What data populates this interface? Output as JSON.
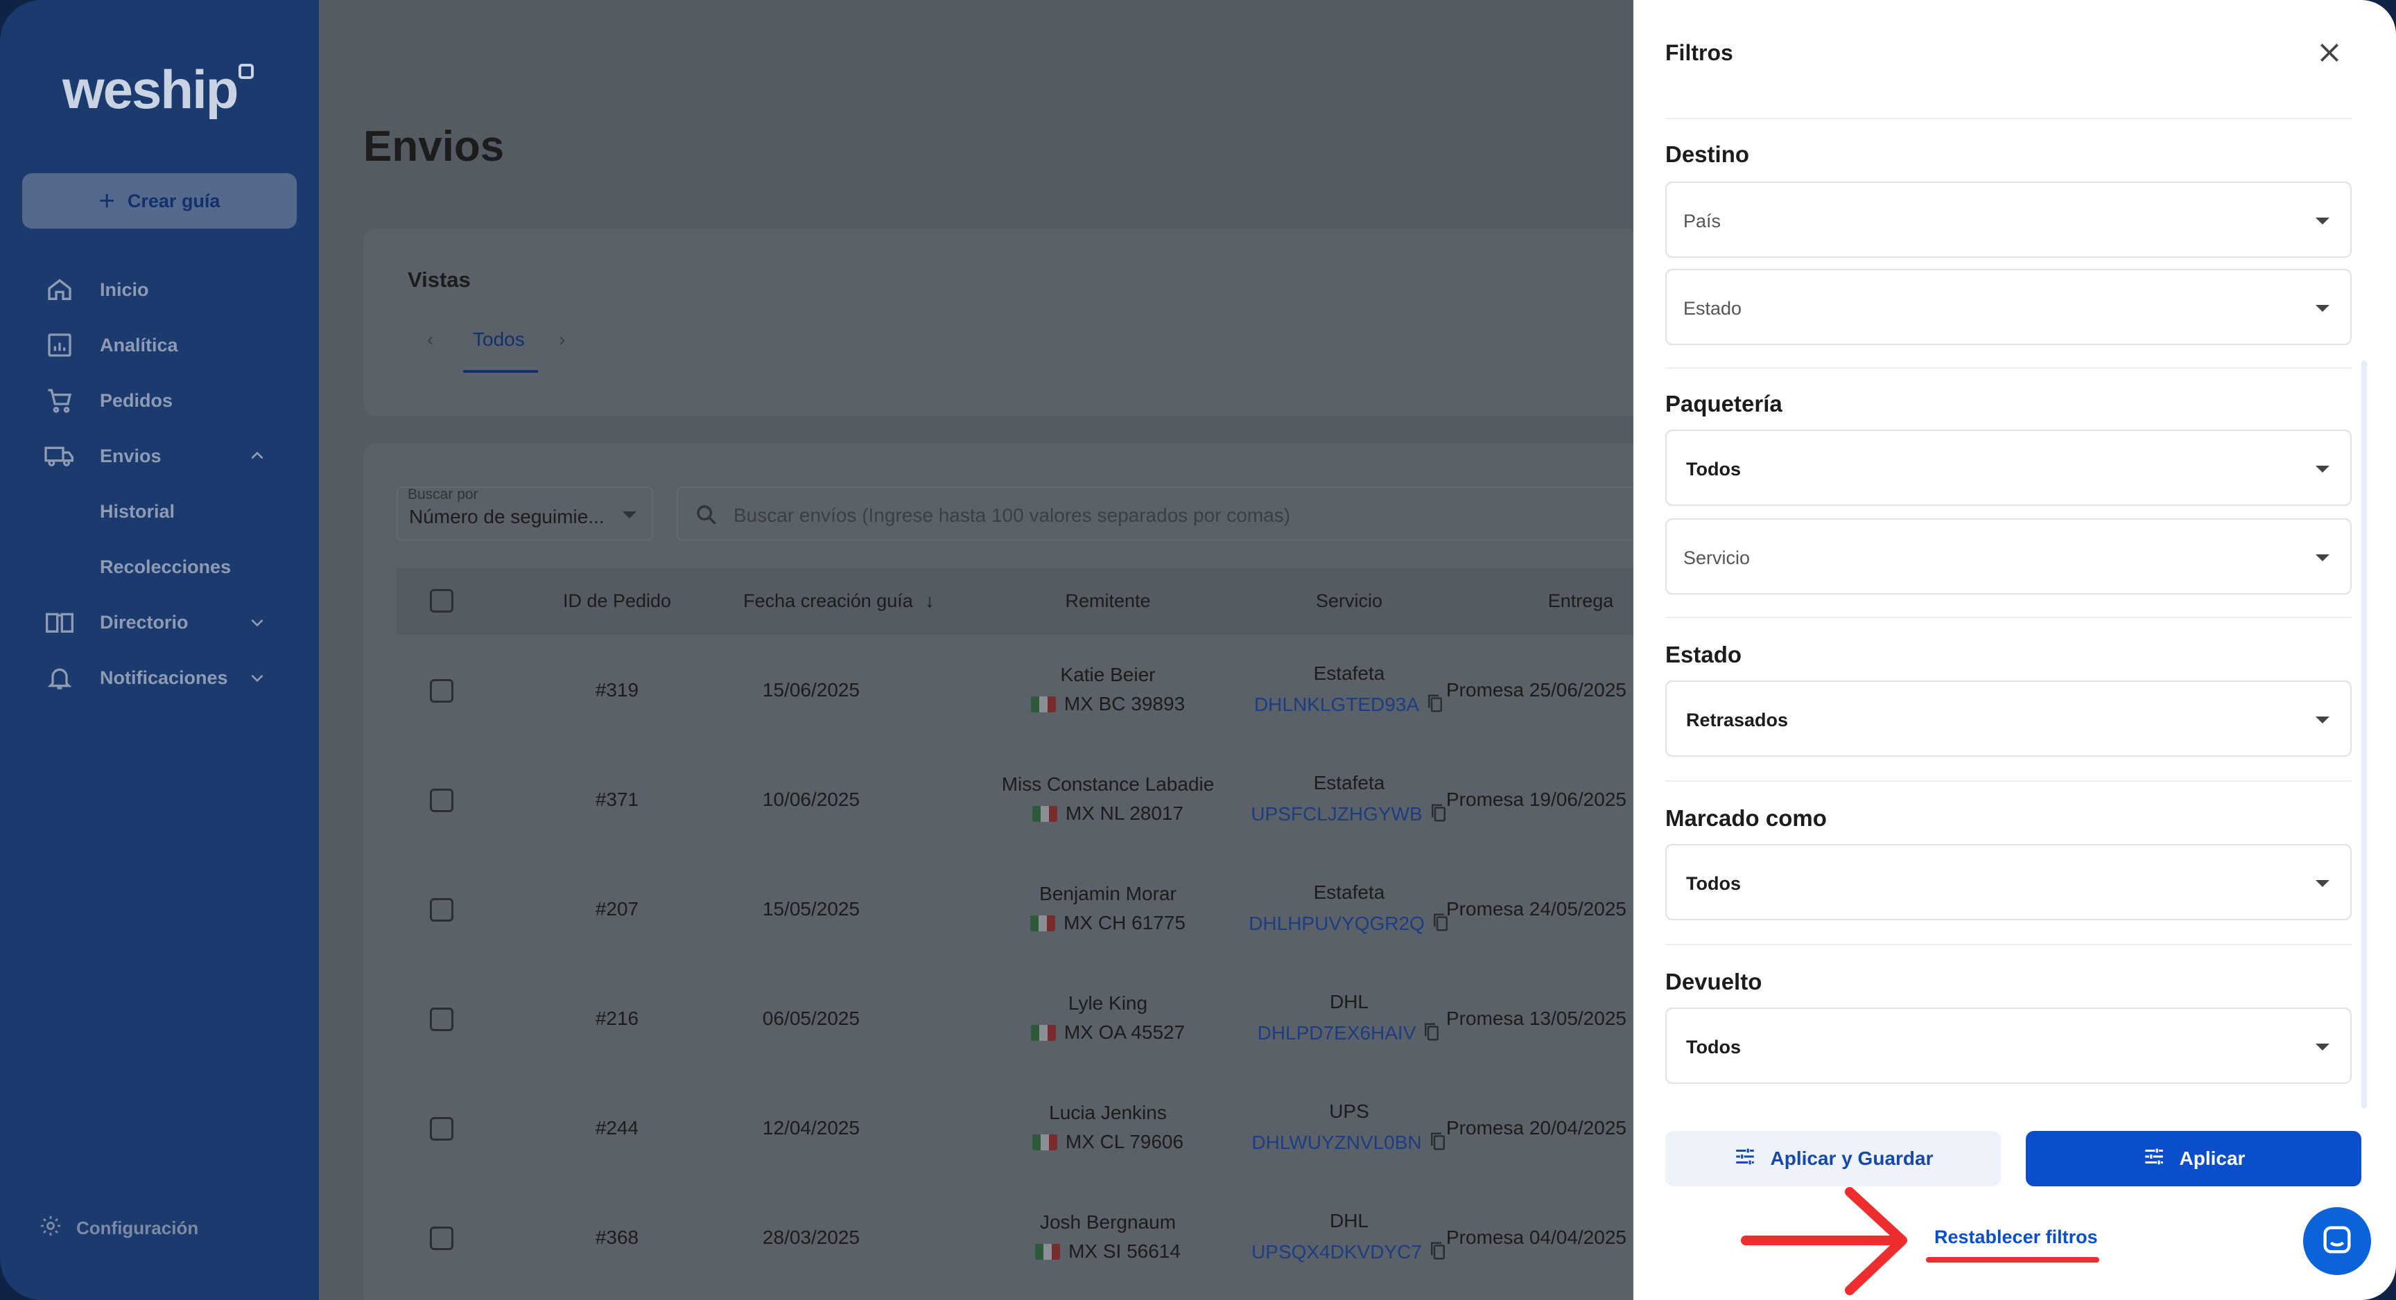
{
  "brand": {
    "logo_text": "weship"
  },
  "sidebar": {
    "create_label": "Crear guía",
    "items": [
      {
        "label": "Inicio",
        "icon": "home-icon"
      },
      {
        "label": "Analítica",
        "icon": "chart-icon"
      },
      {
        "label": "Pedidos",
        "icon": "cart-icon"
      },
      {
        "label": "Envios",
        "icon": "truck-icon"
      },
      {
        "label": "Historial"
      },
      {
        "label": "Recolecciones"
      },
      {
        "label": "Directorio",
        "icon": "book-icon"
      },
      {
        "label": "Notificaciones",
        "icon": "bell-icon"
      }
    ],
    "config_label": "Configuración"
  },
  "main": {
    "title": "Envios",
    "views_label": "Vistas",
    "active_tab": "Todos",
    "search_by_label": "Buscar por",
    "search_by_value": "Número de seguimie...",
    "search_placeholder": "Buscar envíos (Ingrese hasta 100 valores separados por comas)",
    "columns": [
      "ID de Pedido",
      "Fecha creación guía",
      "Remitente",
      "Servicio",
      "Entrega"
    ],
    "rows": [
      {
        "id": "#319",
        "date": "15/06/2025",
        "sender": "Katie Beier",
        "location": "MX BC 39893",
        "carrier": "Estafeta",
        "tracking": "DHLNKLGTED93A",
        "delivery": "Promesa 25/06/2025"
      },
      {
        "id": "#371",
        "date": "10/06/2025",
        "sender": "Miss Constance Labadie",
        "location": "MX NL 28017",
        "carrier": "Estafeta",
        "tracking": "UPSFCLJZHGYWB",
        "delivery": "Promesa 19/06/2025"
      },
      {
        "id": "#207",
        "date": "15/05/2025",
        "sender": "Benjamin Morar",
        "location": "MX CH 61775",
        "carrier": "Estafeta",
        "tracking": "DHLHPUVYQGR2Q",
        "delivery": "Promesa 24/05/2025"
      },
      {
        "id": "#216",
        "date": "06/05/2025",
        "sender": "Lyle King",
        "location": "MX OA 45527",
        "carrier": "DHL",
        "tracking": "DHLPD7EX6HAIV",
        "delivery": "Promesa 13/05/2025"
      },
      {
        "id": "#244",
        "date": "12/04/2025",
        "sender": "Lucia Jenkins",
        "location": "MX CL 79606",
        "carrier": "UPS",
        "tracking": "DHLWUYZNVL0BN",
        "delivery": "Promesa 20/04/2025"
      },
      {
        "id": "#368",
        "date": "28/03/2025",
        "sender": "Josh Bergnaum",
        "location": "MX SI 56614",
        "carrier": "DHL",
        "tracking": "UPSQX4DKVDYC7",
        "delivery": "Promesa 04/04/2025"
      }
    ]
  },
  "filters": {
    "title": "Filtros",
    "destino": {
      "title": "Destino",
      "country_placeholder": "País",
      "state_placeholder": "Estado"
    },
    "paqueteria": {
      "title": "Paquetería",
      "carrier_value": "Todos",
      "service_placeholder": "Servicio"
    },
    "estado": {
      "title": "Estado",
      "value": "Retrasados"
    },
    "marcado": {
      "title": "Marcado como",
      "value": "Todos"
    },
    "devuelto": {
      "title": "Devuelto",
      "value": "Todos"
    },
    "save_label": "Aplicar y Guardar",
    "apply_label": "Aplicar",
    "reset_label": "Restablecer filtros"
  },
  "colors": {
    "primary": "#0a4ecc",
    "sidebar": "#1b3a6d",
    "annotation": "#ee2e2e"
  }
}
